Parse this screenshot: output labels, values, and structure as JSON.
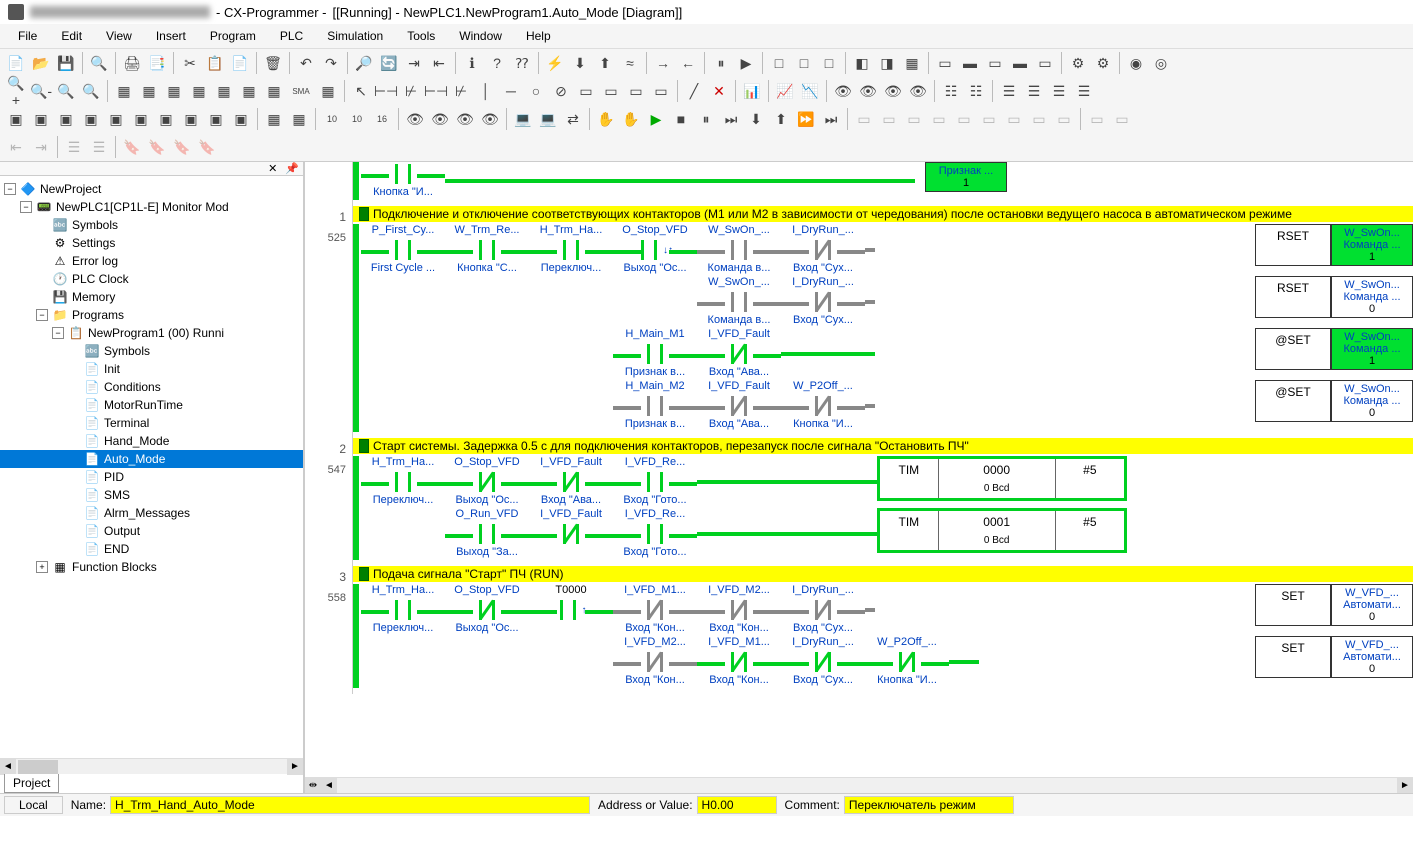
{
  "title": {
    "app": " - CX-Programmer - ",
    "doc": "[[Running] - NewPLC1.NewProgram1.Auto_Mode [Diagram]]"
  },
  "menu": [
    "File",
    "Edit",
    "View",
    "Insert",
    "Program",
    "PLC",
    "Simulation",
    "Tools",
    "Window",
    "Help"
  ],
  "tree": {
    "root": "NewProject",
    "plc": "NewPLC1[CP1L-E] Monitor Mod",
    "items": [
      "Symbols",
      "Settings",
      "Error log",
      "PLC Clock",
      "Memory",
      "Programs"
    ],
    "program": "NewProgram1 (00) Runni",
    "sections": [
      "Symbols",
      "Init",
      "Conditions",
      "MotorRunTime",
      "Terminal",
      "Hand_Mode",
      "Auto_Mode",
      "PID",
      "SMS",
      "Alrm_Messages",
      "Output",
      "END"
    ],
    "fb": "Function Blocks"
  },
  "sidebar_tab": "Project",
  "rungs": [
    {
      "num": "",
      "step": "",
      "row0": {
        "c1": {
          "bot": "Кнопка \"И..."
        },
        "out": {
          "fn": "",
          "v1": "Признак ...",
          "v3": "1",
          "active": true
        }
      }
    },
    {
      "num": "1",
      "step": "525",
      "comment": "Подключение и отключение соответствующих контакторов (M1 или M2 в зависимости от чередования) после остановки ведущего насоса в автоматическом режиме",
      "row1a": {
        "c1": {
          "top": "P_First_Cy...",
          "bot": "First Cycle ..."
        },
        "c2": {
          "top": "W_Trm_Re...",
          "bot": "Кнопка \"С..."
        },
        "c3": {
          "top": "H_Trm_Ha...",
          "bot": "Переключ..."
        },
        "c4": {
          "top": "O_Stop_VFD",
          "bot": "Выход \"Ос..."
        },
        "c5": {
          "top": "W_SwOn_...",
          "bot": "Команда в..."
        },
        "c6": {
          "top": "I_DryRun_...",
          "bot": "Вход \"Сух..."
        },
        "out": {
          "fn": "RSET",
          "v1": "W_SwOn...",
          "v2": "Команда ...",
          "v3": "1",
          "active": true
        }
      },
      "row1b": {
        "c5": {
          "top": "W_SwOn_...",
          "bot": "Команда в..."
        },
        "c6": {
          "top": "I_DryRun_...",
          "bot": "Вход \"Сух..."
        },
        "out": {
          "fn": "RSET",
          "v1": "W_SwOn...",
          "v2": "Команда ...",
          "v3": "0"
        }
      },
      "row1c": {
        "c5": {
          "top": "H_Main_M1",
          "bot": "Признак в..."
        },
        "c6": {
          "top": "I_VFD_Fault",
          "bot": "Вход \"Ава..."
        },
        "out": {
          "fn": "@SET",
          "v1": "W_SwOn...",
          "v2": "Команда ...",
          "v3": "1",
          "active": true
        }
      },
      "row1d": {
        "c5": {
          "top": "H_Main_M2",
          "bot": "Признак в..."
        },
        "c6": {
          "top": "I_VFD_Fault",
          "bot": "Вход \"Ава..."
        },
        "c7": {
          "top": "W_P2Off_...",
          "bot": "Кнопка \"И..."
        },
        "out": {
          "fn": "@SET",
          "v1": "W_SwOn...",
          "v2": "Команда ...",
          "v3": "0"
        }
      }
    },
    {
      "num": "2",
      "step": "547",
      "comment": "Старт системы. Задержка 0.5 с для подключения контакторов, перезапуск после сигнала \"Остановить ПЧ\"",
      "row2a": {
        "c1": {
          "top": "H_Trm_Ha...",
          "bot": "Переключ..."
        },
        "c2": {
          "top": "O_Stop_VFD",
          "bot": "Выход \"Ос..."
        },
        "c3": {
          "top": "I_VFD_Fault",
          "bot": "Вход \"Ава..."
        },
        "c4": {
          "top": "I_VFD_Re...",
          "bot": "Вход \"Гото..."
        },
        "tim": {
          "fn": "TIM",
          "num": "0000",
          "par": "#5",
          "val": "0 Bcd"
        }
      },
      "row2b": {
        "c2": {
          "top": "O_Run_VFD",
          "bot": "Выход \"За..."
        },
        "c3": {
          "top": "I_VFD_Fault",
          "bot": ""
        },
        "c4": {
          "top": "I_VFD_Re...",
          "bot": "Вход \"Гото..."
        },
        "tim": {
          "fn": "TIM",
          "num": "0001",
          "par": "#5",
          "val": "0 Bcd"
        }
      }
    },
    {
      "num": "3",
      "step": "558",
      "comment": "Подача сигнала \"Старт\" ПЧ (RUN)",
      "row3a": {
        "c1": {
          "top": "H_Trm_Ha...",
          "bot": "Переключ..."
        },
        "c2": {
          "top": "O_Stop_VFD",
          "bot": "Выход \"Ос..."
        },
        "c3": {
          "top": "T0000",
          "bot": ""
        },
        "c4": {
          "top": "I_VFD_M1...",
          "bot": "Вход \"Кон..."
        },
        "c5": {
          "top": "I_VFD_M2...",
          "bot": "Вход \"Кон..."
        },
        "c6": {
          "top": "I_DryRun_...",
          "bot": "Вход \"Сух..."
        },
        "out": {
          "fn": "SET",
          "v1": "W_VFD_...",
          "v2": "Автомати...",
          "v3": "0"
        }
      },
      "row3b": {
        "c4": {
          "top": "I_VFD_M2...",
          "bot": "Вход \"Кон..."
        },
        "c5": {
          "top": "I_VFD_M1...",
          "bot": "Вход \"Кон..."
        },
        "c6": {
          "top": "I_DryRun_...",
          "bot": "Вход \"Сух..."
        },
        "c7": {
          "top": "W_P2Off_...",
          "bot": "Кнопка \"И..."
        },
        "out": {
          "fn": "SET",
          "v1": "W_VFD_...",
          "v2": "Автомати...",
          "v3": "0"
        }
      }
    }
  ],
  "status": {
    "scope": "Local",
    "name_lbl": "Name:",
    "name_val": "H_Trm_Hand_Auto_Mode",
    "addr_lbl": "Address or Value:",
    "addr_val": "H0.00",
    "comment_lbl": "Comment:",
    "comment_val": "Переключатель режим"
  }
}
